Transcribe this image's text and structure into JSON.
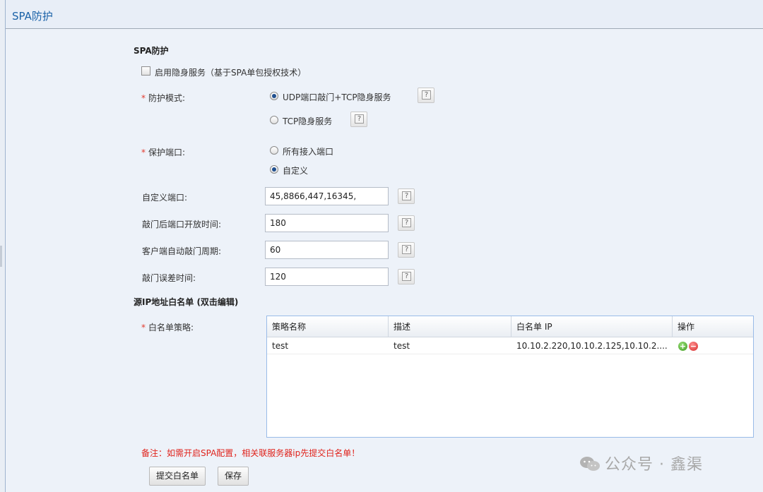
{
  "panel": {
    "title": "SPA防护"
  },
  "section1": {
    "title": "SPA防护"
  },
  "enable_checkbox": {
    "label": "启用隐身服务（基于SPA单包授权技术）",
    "checked": false
  },
  "protect_mode": {
    "label": "防护模式:",
    "required_mark": "*",
    "options": [
      {
        "label": "UDP端口敲门+TCP隐身服务",
        "checked": true
      },
      {
        "label": "TCP隐身服务",
        "checked": false
      }
    ]
  },
  "protect_port": {
    "label": "保护端口:",
    "required_mark": "*",
    "options": [
      {
        "label": "所有接入端口",
        "checked": false
      },
      {
        "label": "自定义",
        "checked": true
      }
    ]
  },
  "fields": [
    {
      "label": "自定义端口:",
      "value": "45,8866,447,16345,"
    },
    {
      "label": "敲门后端口开放时间:",
      "value": "180"
    },
    {
      "label": "客户端自动敲门周期:",
      "value": "60"
    },
    {
      "label": "敲门误差时间:",
      "value": "120"
    }
  ],
  "help_icon_glyph": "?",
  "section2": {
    "title": "源IP地址白名单 (双击编辑)"
  },
  "whitelist": {
    "label": "白名单策略:",
    "required_mark": "*",
    "columns": [
      "策略名称",
      "描述",
      "白名单 IP",
      "操作"
    ],
    "rows": [
      {
        "name": "test",
        "desc": "test",
        "ip": "10.10.2.220,10.10.2.125,10.10.2...."
      }
    ]
  },
  "note": "备注：如需开启SPA配置，相关联服务器ip先提交白名单！",
  "buttons": {
    "submit": "提交白名单",
    "save": "保存"
  },
  "watermark": "公众号 · 鑫渠",
  "colors": {
    "title": "#1b62a8",
    "required": "#e23b2e",
    "note": "#e0231c",
    "background": "#edf2f9"
  }
}
